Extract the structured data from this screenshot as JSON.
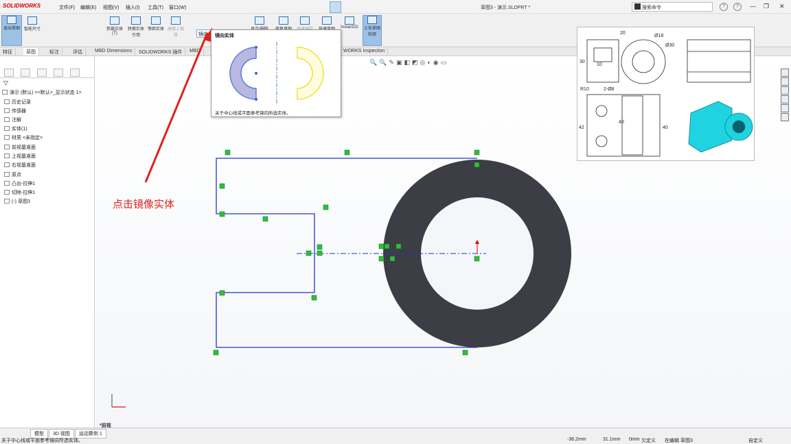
{
  "app": {
    "brand": "SOLIDWORKS",
    "title": "草图3 - 演示.SLDPRT *"
  },
  "menu": [
    "文件(F)",
    "编辑(E)",
    "视图(V)",
    "插入(I)",
    "工具(T)",
    "窗口(W)"
  ],
  "search": {
    "placeholder": "搜索命令"
  },
  "commands": {
    "exit_sketch": "退出草图",
    "smart_dim": "智能尺寸",
    "trim": "剪裁实体(T)",
    "convert": "转换实体引用",
    "offset": "等距实体",
    "project": "曲面上偏移",
    "mirror": "镜向实体",
    "show_relations": "显示/删除",
    "repair": "修复草图",
    "rapid": "快速捕捉",
    "quick_view": "快速草图",
    "instant2d": "Instant2D",
    "shaded": "上色草图轮廓"
  },
  "tabs": [
    "特征",
    "草图",
    "标注",
    "评估",
    "MBD Dimensions",
    "SOLIDWORKS 插件",
    "MBD",
    "WORKS Inspection"
  ],
  "tooltip": {
    "title": "镜向实体",
    "desc": "关于中心线或平面参考镜向所选实体。",
    "button": "镜向实体"
  },
  "tree": [
    {
      "label": "演示 (默认) <<默认>_显示状态 1>"
    },
    {
      "label": "历史记录"
    },
    {
      "label": "传感器"
    },
    {
      "label": "注解"
    },
    {
      "label": "实体(1)"
    },
    {
      "label": "材质 <未指定>"
    },
    {
      "label": "前视基准面"
    },
    {
      "label": "上视基准面"
    },
    {
      "label": "右视基准面"
    },
    {
      "label": "原点"
    },
    {
      "label": "凸台-拉伸1"
    },
    {
      "label": "切除-拉伸1"
    },
    {
      "label": "(-) 草图3"
    }
  ],
  "annotation": "点击镜像实体",
  "reference": {
    "dims": [
      "20",
      "Ø18",
      "Ø30",
      "30",
      "10",
      "R10",
      "2-Ø8",
      "40",
      "42",
      "40"
    ]
  },
  "view_label": "*前视",
  "bottom_tabs": [
    "模型",
    "3D 视图",
    "运动算例 1"
  ],
  "status": {
    "hint": "关于中心线或平面参考镜向所选实体。",
    "x": "-36.2mm",
    "y": "31.1mm",
    "z": "0mm",
    "defined": "欠定义",
    "editing": "在编辑 草图3",
    "custom": "自定义"
  },
  "colors": {
    "sketch_line": "#2233cc",
    "solid": "#3d3d45",
    "relation": "#2fbf3a",
    "annotation": "#e02020",
    "cyan_part": "#1fd3e0"
  }
}
